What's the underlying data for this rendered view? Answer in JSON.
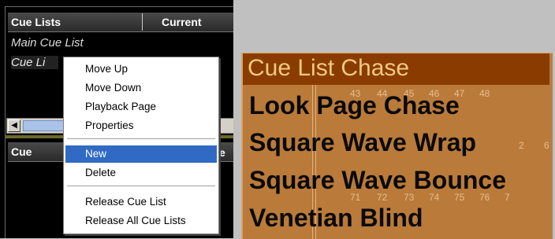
{
  "cue_lists_panel": {
    "header": {
      "col_cue_lists": "Cue Lists",
      "col_current": "Current"
    },
    "rows": [
      "Main Cue List",
      "Cue Li"
    ],
    "bottom_header": {
      "col_cue": "Cue",
      "tail": "e"
    }
  },
  "context_menu": {
    "items": [
      "Move Up",
      "Move Down",
      "Playback Page",
      "Properties",
      "New",
      "Delete",
      "Release Cue List",
      "Release All Cue Lists"
    ],
    "highlighted": "New"
  },
  "chase_overlay": {
    "title": "Cue List Chase",
    "items": [
      "Look Page Chase",
      "Square Wave Wrap",
      "Square Wave Bounce",
      "Venetian Blind"
    ],
    "background_numbers": [
      "43",
      "44",
      "45",
      "46",
      "47",
      "48",
      "2",
      "6",
      "71",
      "72",
      "73",
      "74",
      "75",
      "76",
      "7"
    ],
    "colors": {
      "title_bg": "#8a3c00",
      "body_bg": "#ba7a3a",
      "highlight": "#316ac5"
    }
  }
}
